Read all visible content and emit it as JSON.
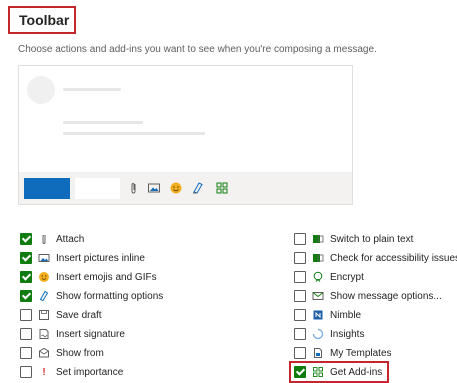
{
  "header": {
    "title": "Toolbar",
    "description": "Choose actions and add-ins you want to see when you're composing a message."
  },
  "left_options": [
    {
      "label": "Attach",
      "checked": true,
      "icon": "paperclip-icon"
    },
    {
      "label": "Insert pictures inline",
      "checked": true,
      "icon": "image-icon"
    },
    {
      "label": "Insert emojis and GIFs",
      "checked": true,
      "icon": "emoji-icon"
    },
    {
      "label": "Show formatting options",
      "checked": true,
      "icon": "format-pen-icon"
    },
    {
      "label": "Save draft",
      "checked": false,
      "icon": "save-icon"
    },
    {
      "label": "Insert signature",
      "checked": false,
      "icon": "signature-icon"
    },
    {
      "label": "Show from",
      "checked": false,
      "icon": "show-from-icon"
    },
    {
      "label": "Set importance",
      "checked": false,
      "icon": "importance-icon"
    }
  ],
  "right_options": [
    {
      "label": "Switch to plain text",
      "checked": false,
      "icon": "plain-text-icon"
    },
    {
      "label": "Check for accessibility issues",
      "checked": false,
      "icon": "accessibility-icon"
    },
    {
      "label": "Encrypt",
      "checked": false,
      "icon": "encrypt-icon"
    },
    {
      "label": "Show message options...",
      "checked": false,
      "icon": "message-options-icon"
    },
    {
      "label": "Nimble",
      "checked": false,
      "icon": "nimble-icon"
    },
    {
      "label": "Insights",
      "checked": false,
      "icon": "insights-icon"
    },
    {
      "label": "My Templates",
      "checked": false,
      "icon": "templates-icon"
    },
    {
      "label": "Get Add-ins",
      "checked": true,
      "icon": "get-addins-icon"
    }
  ],
  "colors": {
    "accent": "#0f6cbd",
    "checked": "#107c10",
    "highlight": "#c4262e"
  }
}
